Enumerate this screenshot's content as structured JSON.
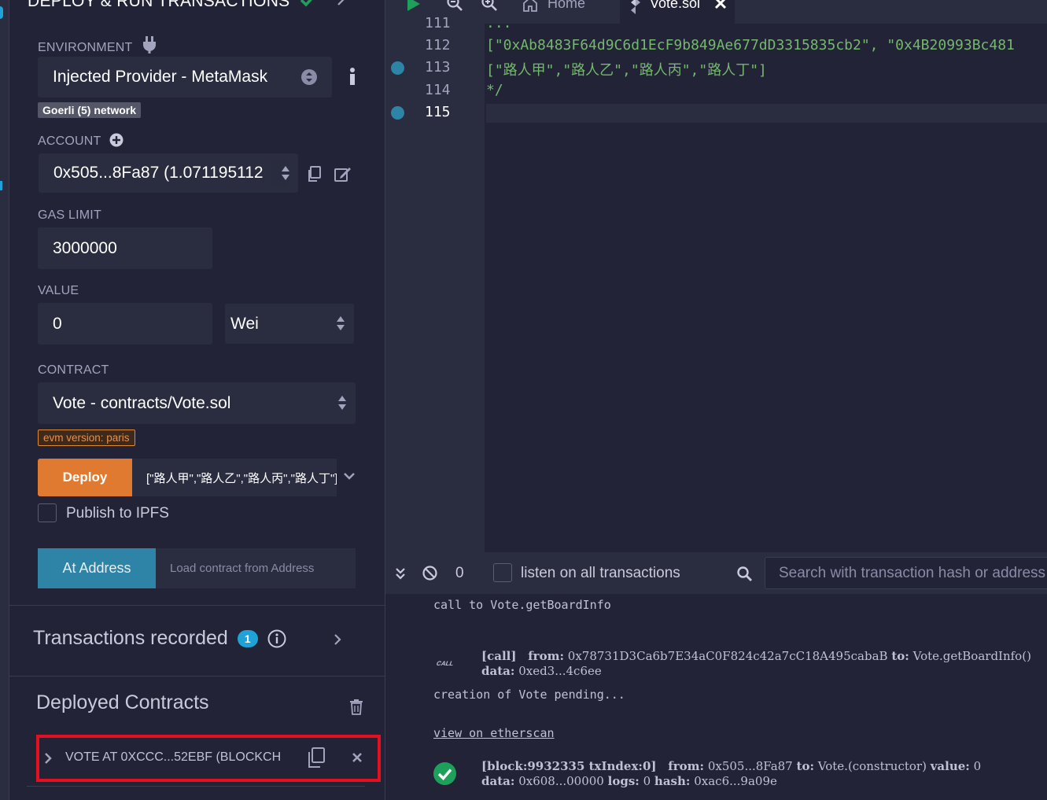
{
  "panel": {
    "title": "DEPLOY & RUN TRANSACTIONS",
    "environment": {
      "label": "ENVIRONMENT",
      "value": "Injected Provider - MetaMask",
      "network_badge": "Goerli (5) network"
    },
    "account": {
      "label": "ACCOUNT",
      "value": "0x505...8Fa87 (1.071195112"
    },
    "gas_limit": {
      "label": "GAS LIMIT",
      "value": "3000000"
    },
    "value": {
      "label": "VALUE",
      "amount": "0",
      "unit": "Wei"
    },
    "contract": {
      "label": "CONTRACT",
      "value": "Vote - contracts/Vote.sol",
      "evm_badge": "evm version: paris"
    },
    "deploy": {
      "button_label": "Deploy",
      "args_value": "[\"路人甲\",\"路人乙\",\"路人丙\",\"路人丁\"]"
    },
    "publish_ipfs": {
      "label": "Publish to IPFS",
      "checked": false
    },
    "at_address": {
      "button_label": "At Address",
      "placeholder": "Load contract from Address"
    },
    "transactions_recorded": {
      "label": "Transactions recorded",
      "count": "1"
    },
    "deployed_contracts": {
      "label": "Deployed Contracts",
      "items": [
        {
          "label": "VOTE AT 0XCCC...52EBF (BLOCKCH"
        }
      ]
    }
  },
  "editor": {
    "tabs": [
      {
        "label": "Home"
      },
      {
        "label": "Vote.sol"
      }
    ],
    "lines": [
      {
        "number": "111",
        "text": "...",
        "color": "#73b86c"
      },
      {
        "number": "112",
        "text": "[\"0xAb8483F64d9C6d1EcF9b849Ae677dD3315835cb2\", \"0x4B20993Bc481",
        "color": "#73b86c"
      },
      {
        "number": "113",
        "text": "[\"路人甲\",\"路人乙\",\"路人丙\",\"路人丁\"]",
        "color": "#73b86c"
      },
      {
        "number": "114",
        "text": "*/",
        "color": "#73b86c"
      },
      {
        "number": "115",
        "text": "",
        "color": "#73b86c"
      }
    ]
  },
  "terminal": {
    "pending_count": "0",
    "listen_label": "listen on all transactions",
    "search_placeholder": "Search with transaction hash or address",
    "log": {
      "line1": "call to Vote.getBoardInfo",
      "call_tag": "CALL",
      "call_head": "[call]",
      "from_label": "from:",
      "call_from": "0x78731D3Ca6b7E34aC0F824c42a7cC18A495cabaB",
      "to_label": "to:",
      "call_to": "Vote.getBoardInfo()",
      "data_label": "data:",
      "call_data": "0xed3...4c6ee",
      "pending_text": "creation of Vote pending...",
      "etherscan_link": "view on etherscan",
      "tx_head": "[block:9932335 txIndex:0]",
      "tx_from": "0x505...8Fa87",
      "tx_to": "Vote.(constructor)",
      "value_label": "value:",
      "tx_value": "0",
      "tx_data": "0x608...00000",
      "logs_label": "logs:",
      "tx_logs": "0",
      "hash_label": "hash:",
      "tx_hash": "0xac6...9a09e"
    }
  },
  "colors": {
    "background": "#222336",
    "panel_field": "#2a2c3f",
    "deploy_orange": "#e17a31",
    "at_address_blue": "#2e84a6",
    "code_green": "#73b86c",
    "success_green": "#1fa05a",
    "highlight_red": "#e5101f"
  }
}
